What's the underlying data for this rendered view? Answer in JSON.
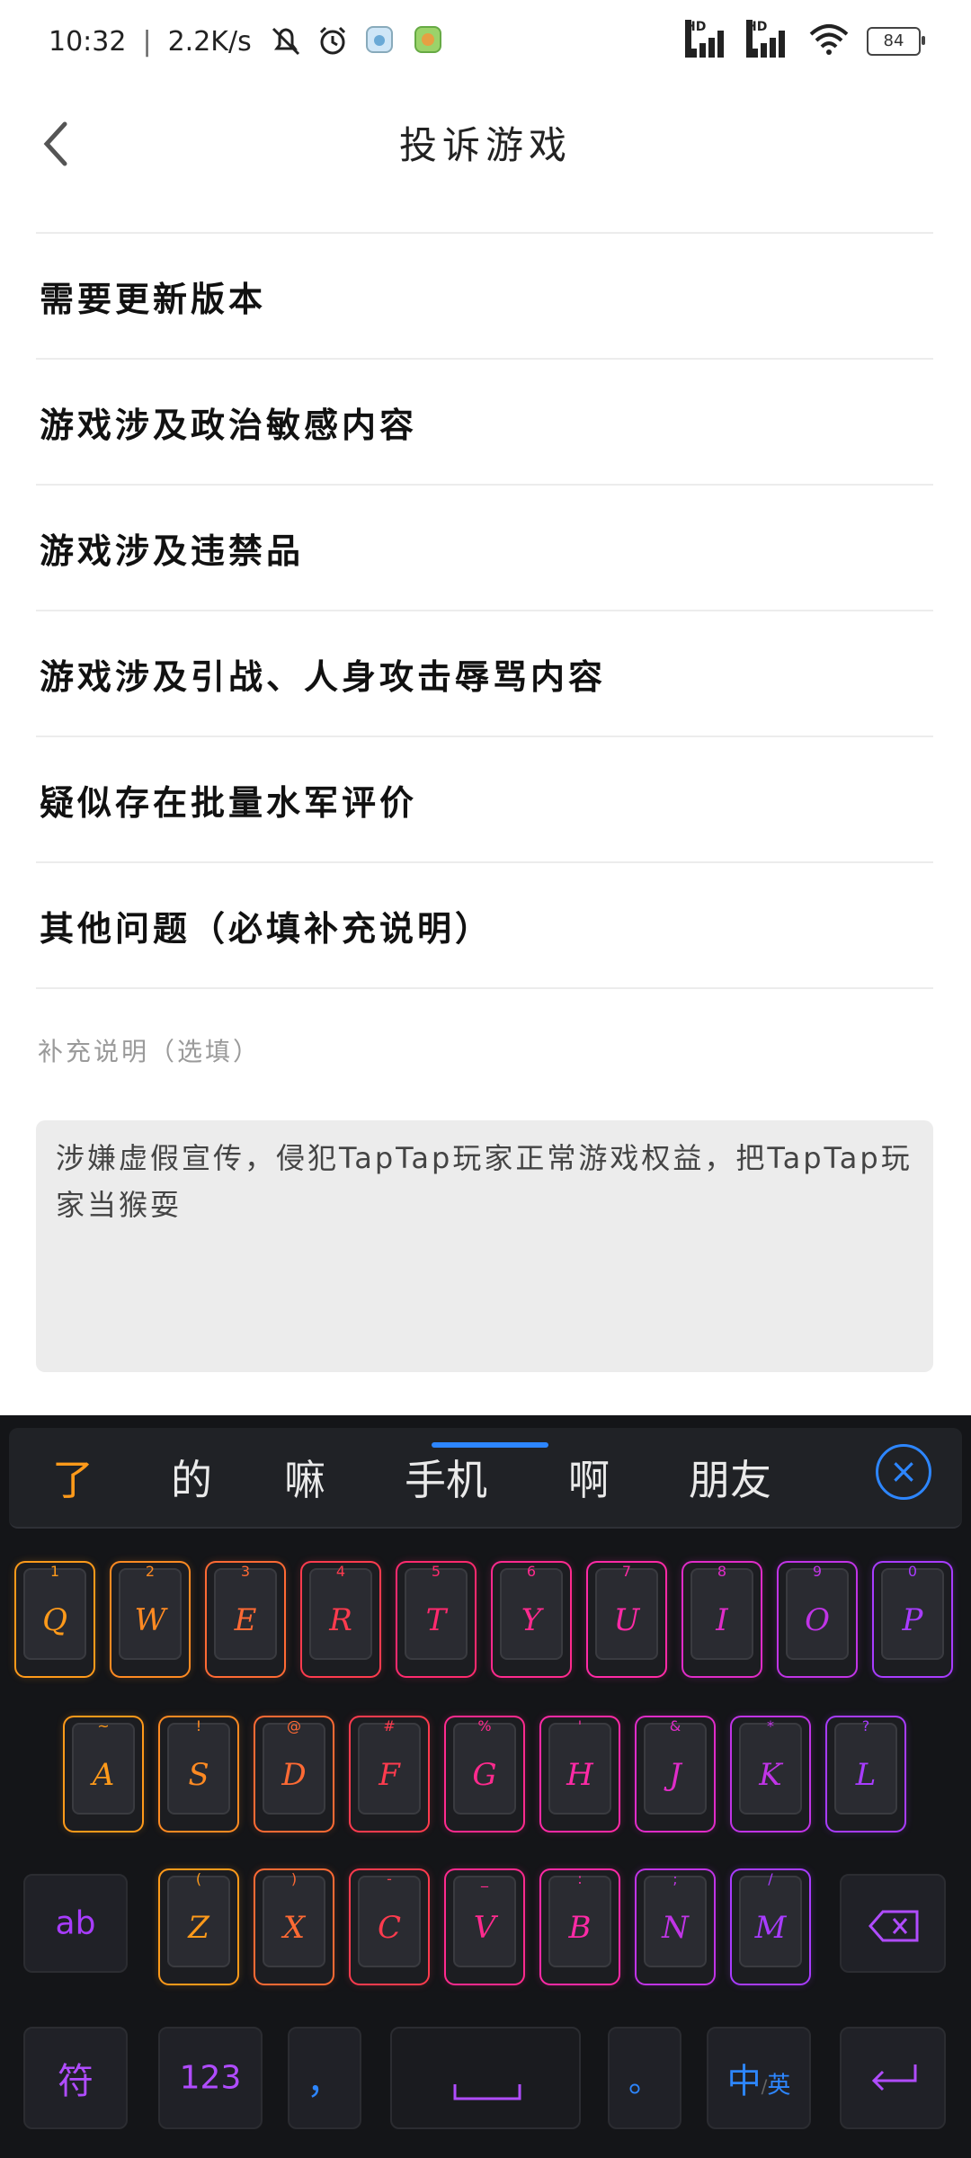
{
  "status": {
    "time": "10:32",
    "speed": "2.2K/s",
    "battery": "84",
    "signal1": "HD",
    "signal2": "HD"
  },
  "header": {
    "title": "投诉游戏"
  },
  "options": [
    "需要更新版本",
    "游戏涉及政治敏感内容",
    "游戏涉及违禁品",
    "游戏涉及引战、人身攻击辱骂内容",
    "疑似存在批量水军评价",
    "其他问题（必填补充说明）"
  ],
  "supplement": {
    "label": "补充说明（选填）",
    "value": "涉嫌虚假宣传，侵犯TapTap玩家正常游戏权益，把TapTap玩家当猴耍"
  },
  "keyboard": {
    "candidates": [
      "了",
      "的",
      "嘛",
      "手机",
      "啊",
      "朋友"
    ],
    "row1": [
      "Q",
      "W",
      "E",
      "R",
      "T",
      "Y",
      "U",
      "I",
      "O",
      "P"
    ],
    "row1_sub": [
      "1",
      "2",
      "3",
      "4",
      "5",
      "6",
      "7",
      "8",
      "9",
      "0"
    ],
    "row2": [
      "A",
      "S",
      "D",
      "F",
      "G",
      "H",
      "J",
      "K",
      "L"
    ],
    "row2_sub": [
      "~",
      "!",
      "@",
      "#",
      "%",
      "'",
      "&",
      "*",
      "?"
    ],
    "row3": [
      "Z",
      "X",
      "C",
      "V",
      "B",
      "N",
      "M"
    ],
    "row3_sub": [
      "(",
      ")",
      "-",
      "_",
      ":",
      ";",
      "/"
    ],
    "mode_key": "ab",
    "symbol_key": "符",
    "number_key": "123",
    "comma_key": "，",
    "period_key": "。",
    "lang_key_main": "中",
    "lang_key_sub": "英",
    "colors": {
      "orange": "#ff9a1a",
      "red": "#ff3b4e",
      "pink": "#ff2aa6",
      "purple": "#a83cff",
      "blue": "#2d86ff"
    }
  }
}
